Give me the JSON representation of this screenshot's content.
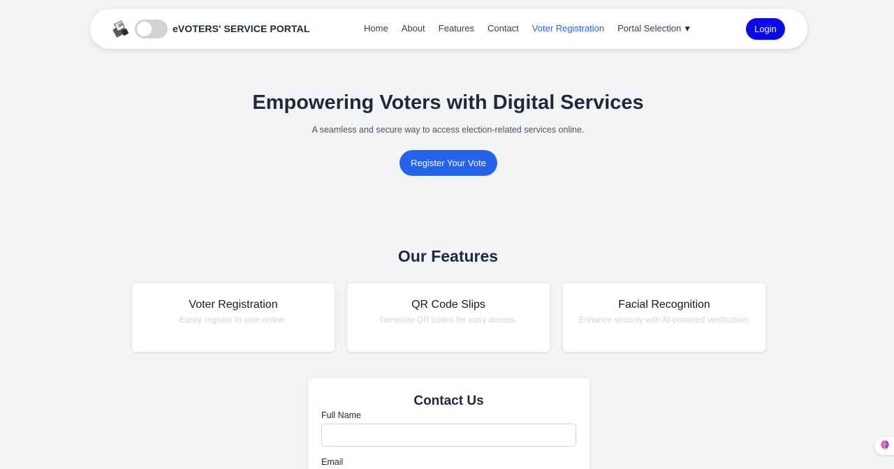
{
  "header": {
    "brand_title": "eVOTERS' SERVICE PORTAL",
    "nav": [
      {
        "label": "Home"
      },
      {
        "label": "About"
      },
      {
        "label": "Features"
      },
      {
        "label": "Contact"
      },
      {
        "label": "Voter Registration"
      },
      {
        "label": "Portal Selection"
      }
    ],
    "dropdown_caret": "▼",
    "login_label": "Login"
  },
  "hero": {
    "title": "Empowering Voters with Digital Services",
    "subtitle": "A seamless and secure way to access election-related services online.",
    "cta_label": "Register Your Vote"
  },
  "features": {
    "title": "Our Features",
    "cards": [
      {
        "title": "Voter Registration",
        "description": "Easily register to vote online."
      },
      {
        "title": "QR Code Slips",
        "description": "Generate QR codes for easy access."
      },
      {
        "title": "Facial Recognition",
        "description": "Enhance security with AI-powered verification."
      }
    ]
  },
  "contact": {
    "title": "Contact Us",
    "full_name_label": "Full Name",
    "full_name_value": "",
    "email_label": "Email"
  },
  "colors": {
    "primary": "#2563eb",
    "login": "#0a0ae6",
    "background": "#f2f4f6",
    "active_nav": "#2563eb"
  },
  "icons": {
    "brand_logo": "ballot-box-icon",
    "theme_toggle": "toggle-switch",
    "floating": "brain-icon"
  }
}
